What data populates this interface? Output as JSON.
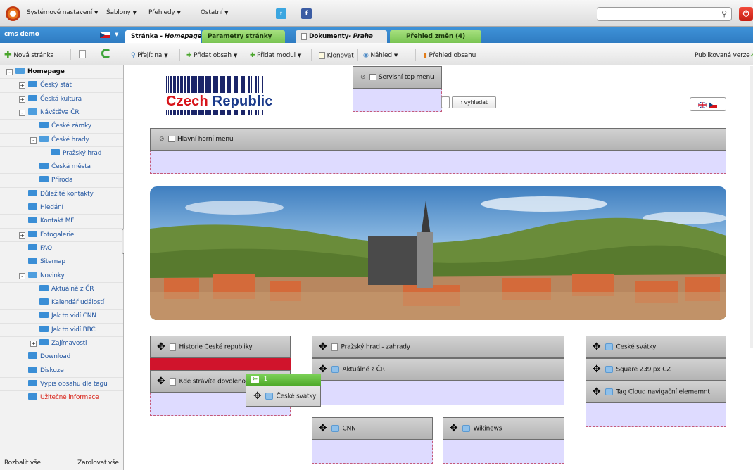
{
  "topbar": {
    "menus": [
      "Systémové nastavení",
      "Šablony",
      "Přehledy",
      "Ostatní"
    ],
    "social_icons": [
      "twitter-icon",
      "facebook-icon"
    ],
    "search_placeholder": "",
    "icons": {
      "search": "magnifier-icon",
      "logout": "power-icon"
    }
  },
  "sidebar": {
    "site_name": "cms demo",
    "language_flag": "czech-flag-icon",
    "new_page_label": "Nová stránka",
    "tree": [
      {
        "label": "Homepage",
        "level": 0,
        "toggle": "-",
        "open": true,
        "bold": true
      },
      {
        "label": "Český stát",
        "level": 1,
        "toggle": "+"
      },
      {
        "label": "Česká kultura",
        "level": 1,
        "toggle": "+"
      },
      {
        "label": "Návštěva ČR",
        "level": 1,
        "toggle": "-",
        "open": true
      },
      {
        "label": "České zámky",
        "level": 2
      },
      {
        "label": "České hrady",
        "level": 2,
        "toggle": "-",
        "open": true
      },
      {
        "label": "Pražský hrad",
        "level": 3
      },
      {
        "label": "Česká města",
        "level": 2
      },
      {
        "label": "Příroda",
        "level": 2
      },
      {
        "label": "Důležité kontakty",
        "level": 1
      },
      {
        "label": "Hledání",
        "level": 1
      },
      {
        "label": "Kontakt MF",
        "level": 1
      },
      {
        "label": "Fotogalerie",
        "level": 1,
        "toggle": "+"
      },
      {
        "label": "FAQ",
        "level": 1
      },
      {
        "label": "Sitemap",
        "level": 1
      },
      {
        "label": "Novinky",
        "level": 1,
        "toggle": "-",
        "open": true
      },
      {
        "label": "Aktuálně z ČR",
        "level": 2
      },
      {
        "label": "Kalendář událostí",
        "level": 2
      },
      {
        "label": "Jak to vidí CNN",
        "level": 2
      },
      {
        "label": "Jak to vidí BBC",
        "level": 2
      },
      {
        "label": "Zajímavosti",
        "level": 2,
        "toggle": "+"
      },
      {
        "label": "Download",
        "level": 1
      },
      {
        "label": "Diskuze",
        "level": 1
      },
      {
        "label": "Výpis obsahu dle tagu",
        "level": 1
      },
      {
        "label": "Užitečné informace",
        "level": 1,
        "color": "#d9261c"
      }
    ],
    "expand_all": "Rozbalit vše",
    "collapse_all": "Zarolovat vše"
  },
  "tabs": {
    "page_tab_prefix": "Stránka - ",
    "page_tab_name": "Homepage",
    "params_tab": "Parametry stránky",
    "docs_tab": "Dokumenty",
    "docs_tab_suffix": "Praha",
    "changes_tab": "Přehled změn (4)"
  },
  "toolbar": {
    "goto": "Přejít na",
    "add_content": "Přidat obsah",
    "add_module": "Přidat modul",
    "clone": "Klonovat",
    "preview": "Náhled",
    "content_overview": "Přehled obsahu",
    "published_version": "Publikovaná verze"
  },
  "page": {
    "servisni_menu": "Servisní top menu",
    "brand_name_part1": "Czech",
    "brand_name_part2": "Republic",
    "search_button": "› vyhledat",
    "lang_flags": [
      "uk-flag-icon",
      "czech-flag-icon"
    ],
    "main_menu": "Hlavní horní menu",
    "widgets": {
      "history": "Historie České republiky",
      "vacation": "Kde strávíte dovolenou",
      "prague_castle": "Pražský hrad - zahrady",
      "news_cr": "Aktuálně z ČR",
      "holidays": "České svátky",
      "square": "Square 239 px CZ",
      "tagcloud": "Tag Cloud navigační elememnt",
      "cnn": "CNN",
      "wikinews": "Wikinews"
    },
    "drag_count": "1",
    "drag_item": "České svátky"
  },
  "colors": {
    "accent_blue": "#3a8ad0",
    "tab_green": "#8ad16a",
    "zone_fill": "#dedbff",
    "drop_red": "#d0142c",
    "drag_green": "#5fbf3a"
  }
}
